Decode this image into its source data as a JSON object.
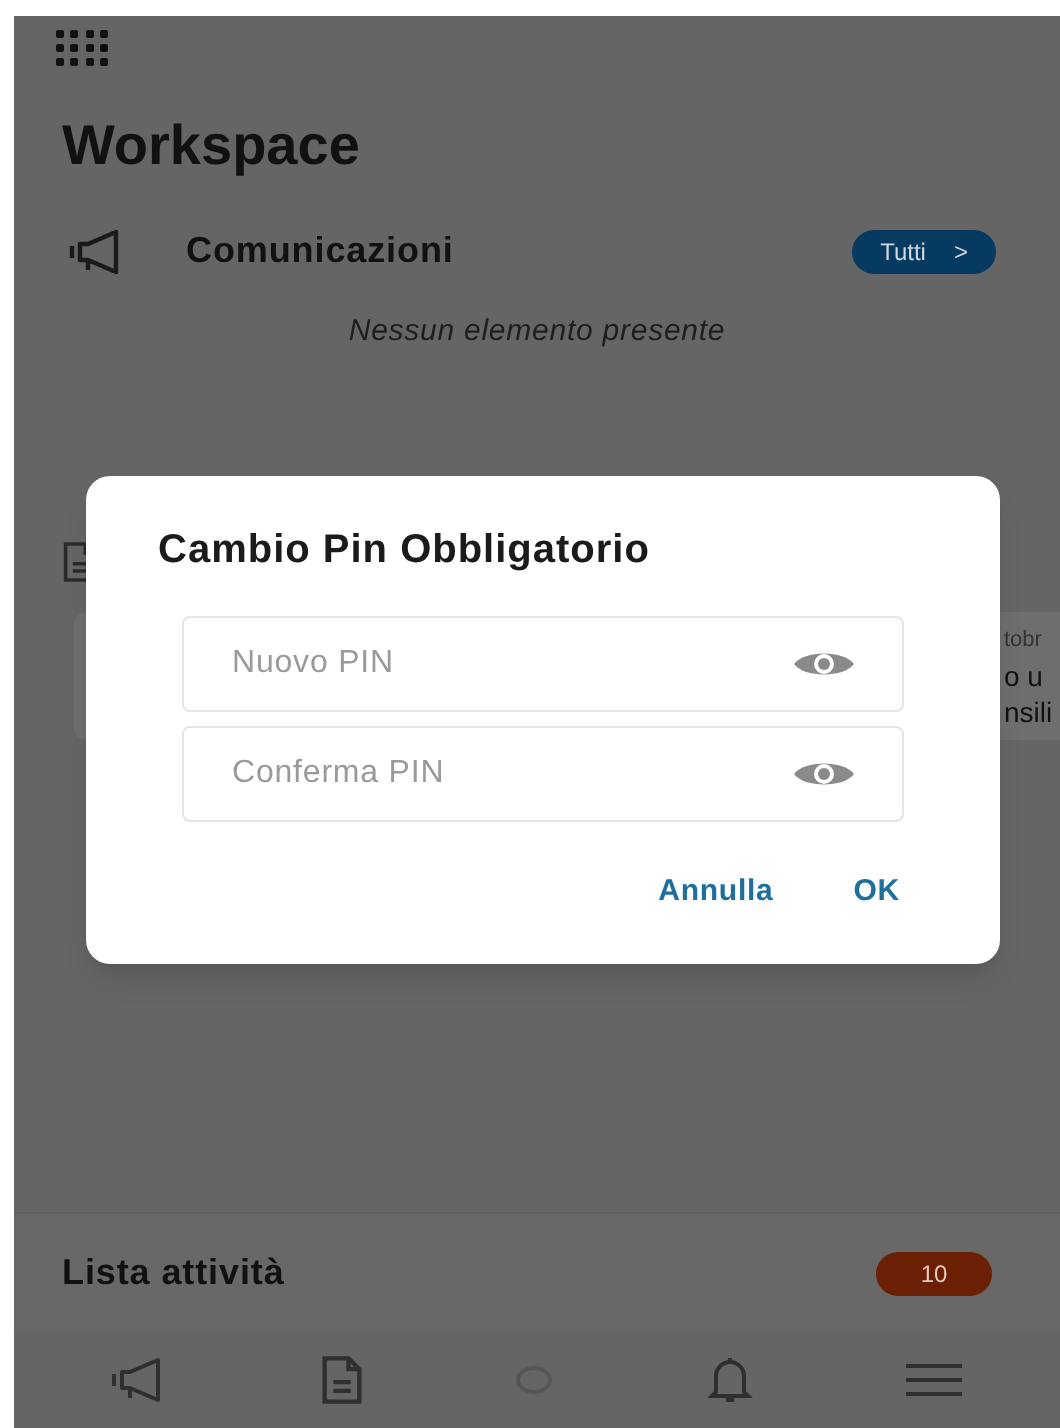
{
  "header": {
    "title": "Workspace"
  },
  "communications": {
    "title": "Comunicazioni",
    "all_button": "Tutti",
    "chevron": ">",
    "empty_text": "Nessun elemento presente"
  },
  "hidden_card": {
    "lines": [
      "tobr",
      "o u",
      "nsili"
    ]
  },
  "dialog": {
    "title": "Cambio Pin Obbligatorio",
    "fields": [
      {
        "placeholder": "Nuovo PIN"
      },
      {
        "placeholder": "Conferma PIN"
      }
    ],
    "buttons": [
      "Annulla",
      "OK"
    ]
  },
  "tasks": {
    "title": "Lista attività",
    "count": "10"
  },
  "bottom_nav": [
    {
      "kind": "megaphone"
    },
    {
      "kind": "document"
    },
    {
      "kind": "circle"
    },
    {
      "kind": "bell"
    },
    {
      "kind": "menu"
    }
  ]
}
